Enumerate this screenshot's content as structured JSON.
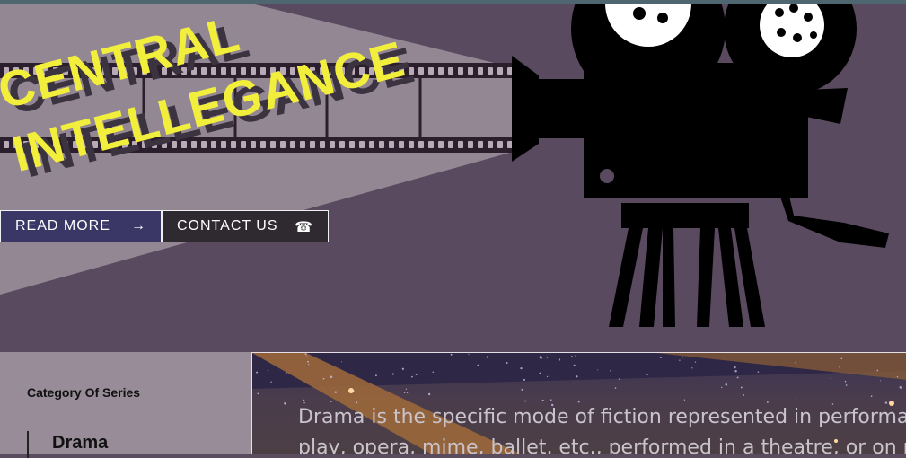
{
  "hero": {
    "title_line1": "CENTRAL",
    "title_line2": "INTELLEGANCE",
    "read_more_label": "READ MORE",
    "read_more_icon": "→",
    "contact_label": "CONTACT US",
    "contact_icon": "☎"
  },
  "sidebar": {
    "title": "Category Of Series",
    "items": [
      {
        "label": "Drama"
      }
    ]
  },
  "banner": {
    "line1": "Drama is the specific mode of fiction represented in performance:",
    "line2": "play, opera, mime, ballet, etc., performed in a theatre, or on radio or"
  },
  "icons": [
    "arrow-right-icon",
    "telephone-icon",
    "movie-camera-illustration",
    "film-strip-illustration"
  ],
  "colors": {
    "title_yellow": "#f2ef3c",
    "hero_bg": "#5a4a5f",
    "beam": "#948794",
    "read_more_bg": "#3a3666",
    "contact_bg": "#2f2a2f",
    "sidebar_bg": "#978c97"
  }
}
